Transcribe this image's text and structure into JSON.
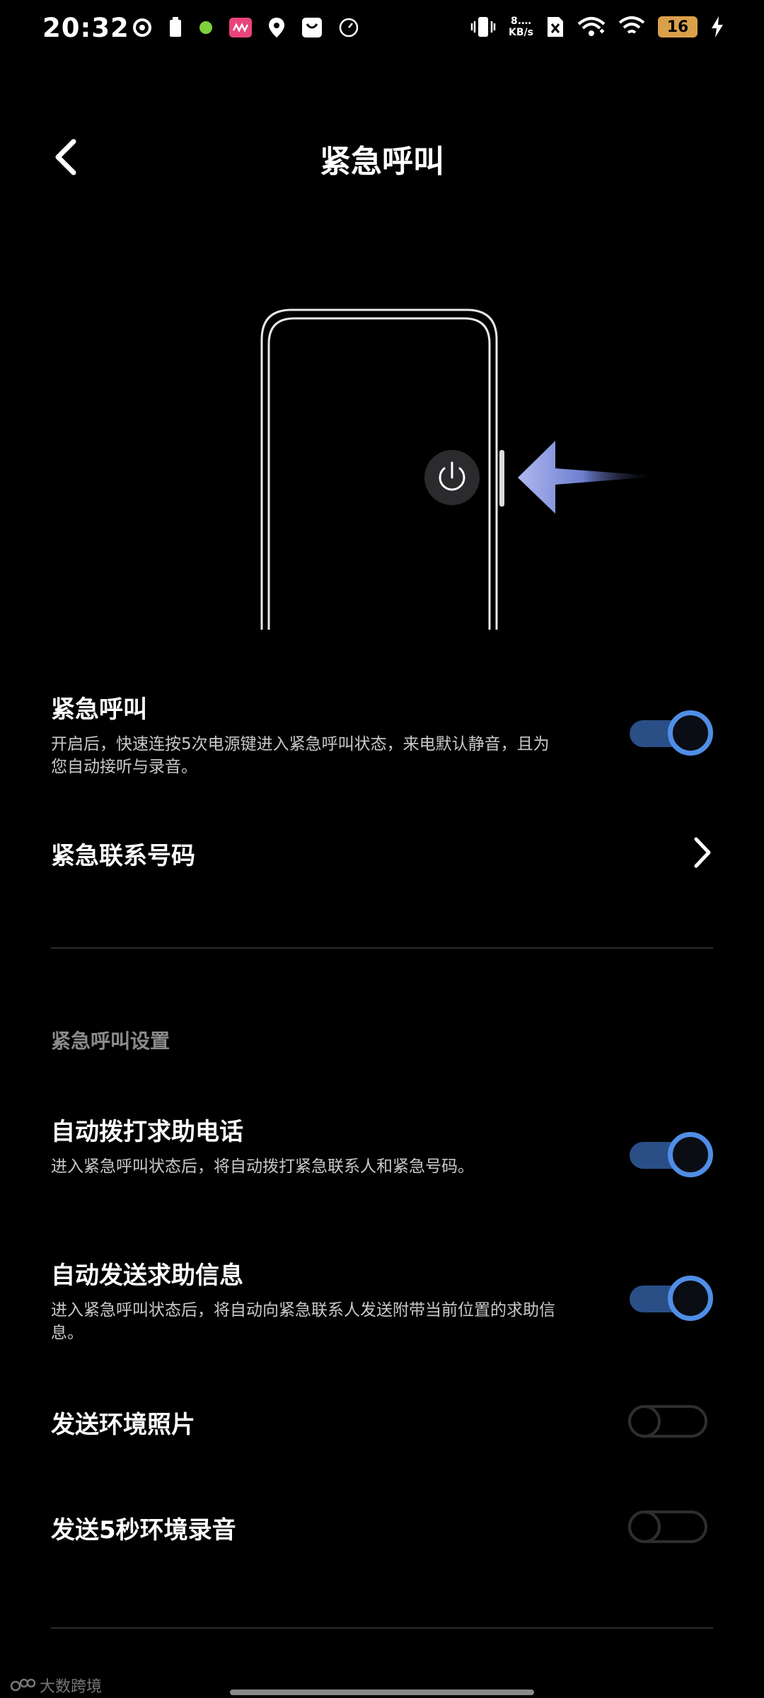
{
  "status_bar": {
    "time": "20:32",
    "net_speed_value": "8.…",
    "net_speed_unit": "KB/s",
    "battery_level": "16",
    "icons_left": [
      "sync-icon",
      "battery-saver-icon",
      "green-dot-icon",
      "app-notification-icon",
      "location-icon",
      "shopping-bag-icon",
      "timer-icon"
    ],
    "icons_right": [
      "vibrate-icon",
      "sim-x-icon",
      "mobile-signal-icon",
      "wifi-icon",
      "battery-icon",
      "charging-icon"
    ]
  },
  "header": {
    "title": "紧急呼叫"
  },
  "emergency_call": {
    "title": "紧急呼叫",
    "description": "开启后，快速连按5次电源键进入紧急呼叫状态，来电默认静音，且为您自动接听与录音。",
    "enabled": true
  },
  "emergency_contacts": {
    "title": "紧急联系号码"
  },
  "settings_section": {
    "label": "紧急呼叫设置",
    "items": [
      {
        "title": "自动拨打求助电话",
        "description": "进入紧急呼叫状态后，将自动拨打紧急联系人和紧急号码。",
        "enabled": true
      },
      {
        "title": "自动发送求助信息",
        "description": "进入紧急呼叫状态后，将自动向紧急联系人发送附带当前位置的求助信息。",
        "enabled": true
      },
      {
        "title": "发送环境照片",
        "description": "",
        "enabled": false
      },
      {
        "title": "发送5秒环境录音",
        "description": "",
        "enabled": false
      }
    ]
  },
  "watermark": {
    "text": "大数跨境"
  },
  "colors": {
    "background": "#000000",
    "toggle_on_ring": "#4f8ee6",
    "toggle_on_track": "#2a4f86",
    "toggle_off": "#2e2e2e",
    "arrow": "#aeb8f0"
  }
}
